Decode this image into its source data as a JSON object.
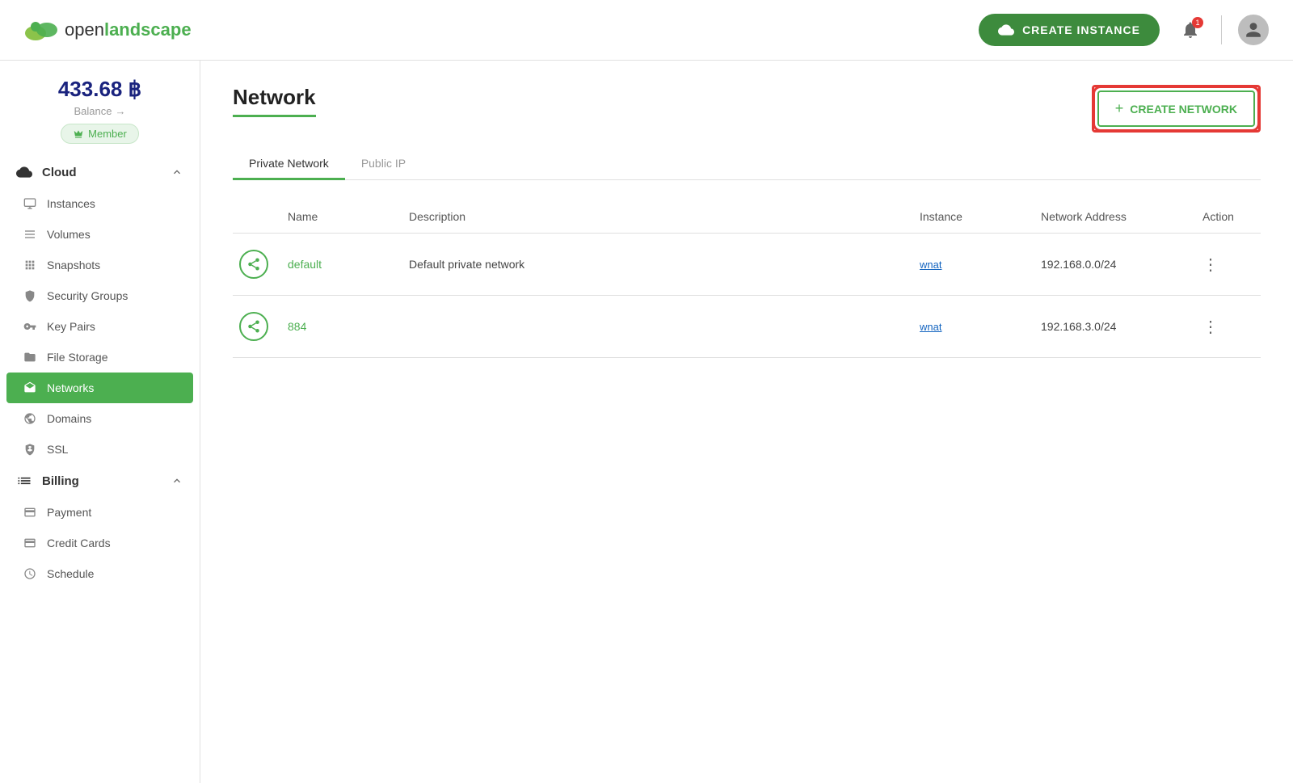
{
  "header": {
    "logo_open": "open",
    "logo_landscape": "landscape",
    "create_instance_label": "CREATE INSTANCE",
    "notification_count": "1",
    "title": "openlandscape"
  },
  "sidebar": {
    "balance": "433.68 ฿",
    "balance_label": "Balance",
    "member_label": "Member",
    "cloud_section_label": "Cloud",
    "nav_items": [
      {
        "id": "instances",
        "label": "Instances",
        "icon": "☐"
      },
      {
        "id": "volumes",
        "label": "Volumes",
        "icon": "≡"
      },
      {
        "id": "snapshots",
        "label": "Snapshots",
        "icon": "⊞"
      },
      {
        "id": "security-groups",
        "label": "Security Groups",
        "icon": "⊙"
      },
      {
        "id": "key-pairs",
        "label": "Key Pairs",
        "icon": "⚿"
      },
      {
        "id": "file-storage",
        "label": "File Storage",
        "icon": "▭"
      },
      {
        "id": "networks",
        "label": "Networks",
        "icon": "↔",
        "active": true
      },
      {
        "id": "domains",
        "label": "Domains",
        "icon": "⊕"
      },
      {
        "id": "ssl",
        "label": "SSL",
        "icon": "⊙"
      }
    ],
    "billing_section_label": "Billing",
    "billing_items": [
      {
        "id": "payment",
        "label": "Payment",
        "icon": "▭"
      },
      {
        "id": "credit-cards",
        "label": "Credit Cards",
        "icon": "▬"
      },
      {
        "id": "schedule",
        "label": "Schedule",
        "icon": "⊙"
      }
    ]
  },
  "page": {
    "title": "Network",
    "create_network_label": "CREATE NETWORK",
    "tabs": [
      {
        "id": "private-network",
        "label": "Private Network",
        "active": true
      },
      {
        "id": "public-ip",
        "label": "Public IP",
        "active": false
      }
    ],
    "table": {
      "headers": [
        "",
        "Name",
        "Description",
        "Instance",
        "Network Address",
        "Action"
      ],
      "rows": [
        {
          "name": "default",
          "description": "Default private network",
          "instance": "wnat",
          "network_address": "192.168.0.0/24"
        },
        {
          "name": "884",
          "description": "",
          "instance": "wnat",
          "network_address": "192.168.3.0/24"
        }
      ]
    }
  }
}
